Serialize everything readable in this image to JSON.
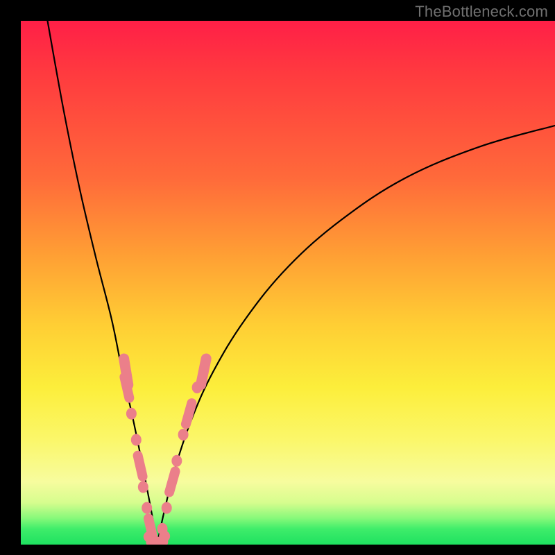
{
  "watermark": "TheBottleneck.com",
  "colors": {
    "background": "#000000",
    "gradient_top": "#ff1f47",
    "gradient_mid": "#fcee3b",
    "gradient_bottom": "#1ee160",
    "curve": "#000000",
    "beads": "#eb7f8a"
  },
  "chart_data": {
    "type": "line",
    "title": "",
    "xlabel": "",
    "ylabel": "",
    "xlim": [
      0,
      100
    ],
    "ylim": [
      0,
      100
    ],
    "notes": "V-shaped bottleneck curve with a sharp minimum around x≈25 reaching y≈0; left branch rises steeply to y≈100 at x≈5; right branch rises with diminishing slope to about y≈80 at x=100. Beads cluster along both branches near the trough (roughly y < 30).",
    "series": [
      {
        "name": "left-branch",
        "x": [
          5,
          8,
          11,
          14,
          17,
          19,
          21,
          23,
          24.5,
          25.5
        ],
        "y": [
          100,
          83,
          68,
          55,
          43,
          33,
          24,
          14,
          6,
          0
        ]
      },
      {
        "name": "right-branch",
        "x": [
          25.5,
          27,
          29,
          32,
          36,
          42,
          50,
          60,
          72,
          86,
          100
        ],
        "y": [
          0,
          7,
          15,
          24,
          33,
          43,
          53,
          62,
          70,
          76,
          80
        ]
      }
    ],
    "beads_left": [
      [
        19.3,
        33
      ],
      [
        19.8,
        30
      ],
      [
        20.7,
        25
      ],
      [
        21.6,
        20
      ],
      [
        22.3,
        15
      ],
      [
        22.9,
        11
      ],
      [
        23.6,
        7
      ],
      [
        24.3,
        3
      ]
    ],
    "beads_right": [
      [
        26.5,
        3
      ],
      [
        27.3,
        7
      ],
      [
        28.3,
        12
      ],
      [
        29.2,
        16
      ],
      [
        30.4,
        21
      ],
      [
        31.4,
        25
      ],
      [
        33.0,
        30
      ],
      [
        34.5,
        33
      ]
    ],
    "beads_bottom": [
      [
        24.0,
        1.5
      ],
      [
        25.0,
        0.5
      ],
      [
        26.0,
        0.5
      ],
      [
        26.9,
        1.6
      ]
    ]
  }
}
